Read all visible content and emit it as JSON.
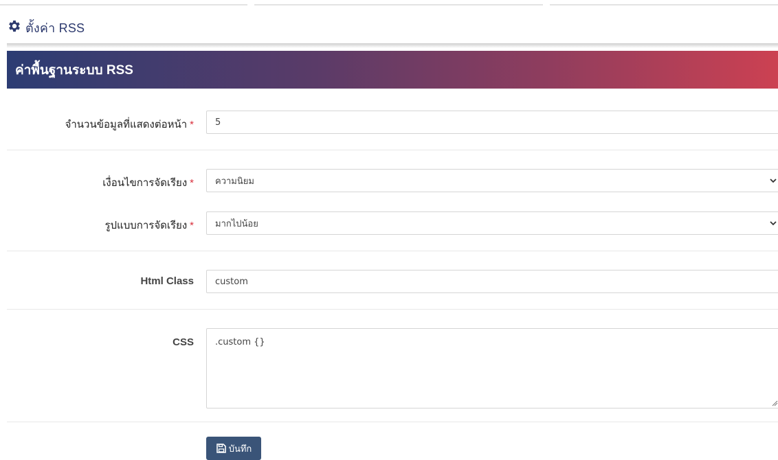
{
  "page": {
    "title": "ตั้งค่า RSS",
    "title_icon": "gear-icon"
  },
  "panel": {
    "title": "ค่าพื้นฐานระบบ RSS",
    "gradient_colors": [
      "#2c3c73",
      "#cc4152"
    ]
  },
  "form": {
    "items_per_page": {
      "label": "จำนวนข้อมูลที่แสดงต่อหน้า",
      "required_mark": "*",
      "value": "5"
    },
    "sort_condition": {
      "label": "เงื่อนไขการจัดเรียง",
      "required_mark": "*",
      "selected": "ความนิยม"
    },
    "sort_order": {
      "label": "รูปแบบการจัดเรียง",
      "required_mark": "*",
      "selected": "มากไปน้อย"
    },
    "html_class": {
      "label": "Html Class",
      "value": "custom"
    },
    "css": {
      "label": "CSS",
      "value": ".custom {}"
    }
  },
  "actions": {
    "save_label": "บันทึก",
    "save_icon": "floppy-disk-icon",
    "save_color": "#3a5478"
  }
}
